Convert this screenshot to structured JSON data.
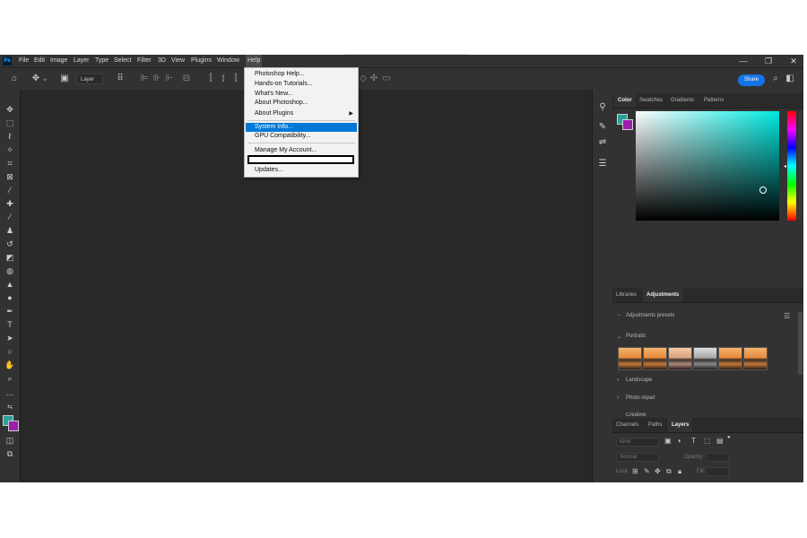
{
  "app": {
    "logo": "Ps",
    "menu": [
      "File",
      "Edit",
      "Image",
      "Layer",
      "Type",
      "Select",
      "Filter",
      "3D",
      "View",
      "Plugins",
      "Window",
      "Help"
    ],
    "active_menu": "Help",
    "window_controls": [
      "—",
      "❐",
      "✕"
    ]
  },
  "options_bar": {
    "layer_select_value": "Layer",
    "share_label": "Share",
    "search_icon": "search-icon",
    "workspace_icon": "workspace-icon"
  },
  "help_menu": {
    "items": [
      {
        "label": "Photoshop Help...",
        "highlighted": false,
        "submenu": false
      },
      {
        "label": "Hands-on Tutorials...",
        "highlighted": false,
        "submenu": false
      },
      {
        "label": "What's New...",
        "highlighted": false,
        "submenu": false
      },
      {
        "label": "About Photoshop...",
        "highlighted": false,
        "submenu": false
      },
      {
        "label": "About Plugins",
        "highlighted": false,
        "submenu": true
      },
      {
        "label": "System Info...",
        "highlighted": true,
        "submenu": false
      },
      {
        "label": "GPU Compatibility...",
        "highlighted": false,
        "submenu": false
      },
      {
        "label": "Manage My Account...",
        "highlighted": false,
        "submenu": false
      },
      {
        "label": "",
        "highlighted": false,
        "submenu": false
      },
      {
        "label": "Updates...",
        "highlighted": false,
        "submenu": false
      }
    ]
  },
  "color_panel": {
    "tabs": [
      "Color",
      "Swatches",
      "Gradients",
      "Patterns"
    ],
    "active_tab": "Color",
    "foreground_color": "#2aa198",
    "background_color": "#9c1eae"
  },
  "adjustments_panel": {
    "tabs": [
      "Libraries",
      "Adjustments"
    ],
    "active_tab": "Adjustments",
    "header": "Adjustments presets",
    "sections": [
      "Portraits",
      "Landscape",
      "Photo repair",
      "Creative"
    ]
  },
  "layers_panel": {
    "tabs": [
      "Channels",
      "Paths",
      "Layers"
    ],
    "active_tab": "Layers",
    "search_placeholder": "Kind",
    "blend_mode": "Normal",
    "opacity_label": "Opacity:",
    "lock_label": "Lock:",
    "fill_label": "Fill:"
  }
}
